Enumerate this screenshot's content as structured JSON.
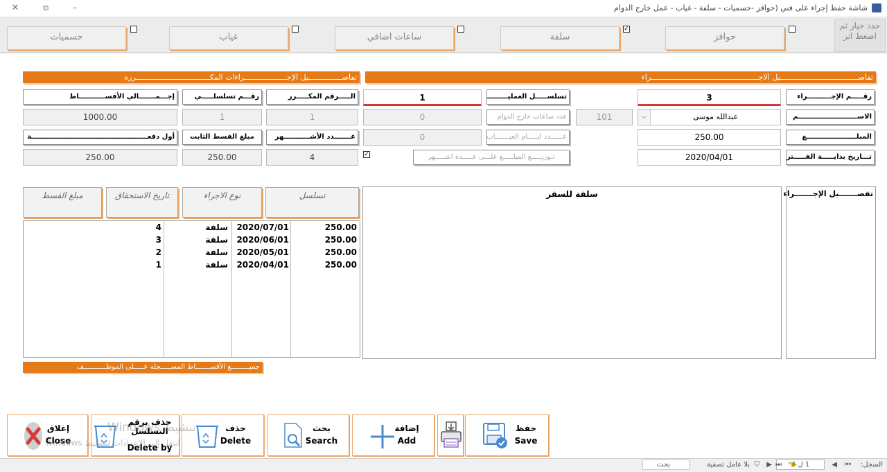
{
  "window": {
    "title": "شاشة حفظ إجراء على فني (حوافز -حسميات - سلفة - غياب - عمل خارج الدوام"
  },
  "categories": {
    "hint": "حدد خيار ثم اضغط اثر",
    "items": [
      {
        "label": "حوافز",
        "checked": false
      },
      {
        "label": "سلفة",
        "checked": true
      },
      {
        "label": "ساعات اضافي",
        "checked": false
      },
      {
        "label": "غياب",
        "checked": false
      },
      {
        "label": "حسميات",
        "checked": false
      }
    ]
  },
  "sections": {
    "right_title": "تفاصـــــــــــــــــــــــــــــــــــيل الاجــــــــــــــــــــــــــــــــــــــــــــــــراء",
    "left_title": "تفاصـــــــــــــــيل الإجـــــــــــــــــــراءات المكـــــــــــــــــــــــــــــــــرره"
  },
  "labels": {
    "proc_no": "رقـــــم الإجــــــــــراء",
    "op_seq": "تسلســـــل العمليـــــــــة",
    "name": "الاســـــــــــــــــــــــــم",
    "overtime_hours": "عدد ساعات خارج الدوام",
    "amount": "المبلـــــــــــــــــــــغ",
    "absence_days": "عــــــدد ايـــــام الغيـــــــاب",
    "period_start": "تـــاريخ بدايـــــة الفـــــترة",
    "distribute": "تـوزيـــــع المبلـــــغ علـــى عـــــدة اشـــــهر",
    "total_installments": "إجـــمـــــــالي الأقســـــــــــاط",
    "serial_no": "رقـــم تسلسلـــــي",
    "repeated_no": "الـــــرقم المكـــــرر",
    "months_count": "عـــــــدد الأشـــــــــــهر",
    "fixed_installment": "مبلغ القسط الثابت",
    "first_payment": "أول دفعـــــــــــــــــــــــــــــــــــــــــــــــــة",
    "proc_detail": "تفصـــــــيل الإجـــــــراء"
  },
  "values": {
    "proc_no": "3",
    "op_seq": "1",
    "name": "عبدالله موسى",
    "name_code": "101",
    "overtime_hours": "0",
    "amount": "250.00",
    "absence_days": "0",
    "period_start": "2020/04/01",
    "distribute_checked": true,
    "total_installments": "1000.00",
    "serial_no": "1",
    "repeated_no": "1",
    "months_count": "4",
    "fixed_installment": "250.00",
    "first_payment": "250.00",
    "memo": "سلفة للسفر"
  },
  "grid": {
    "columns": [
      "تسلسل",
      "نوع الاجراء",
      "تاريخ الاستحقاق",
      "مبلغ القسط"
    ],
    "rows": [
      {
        "amount": "250.00",
        "date": "2020/07/01",
        "type": "سلفة",
        "seq": "4"
      },
      {
        "amount": "250.00",
        "date": "2020/06/01",
        "type": "سلفة",
        "seq": "3"
      },
      {
        "amount": "250.00",
        "date": "2020/05/01",
        "type": "سلفة",
        "seq": "2"
      },
      {
        "amount": "250.00",
        "date": "2020/04/01",
        "type": "سلفة",
        "seq": "1"
      }
    ],
    "footer": "جميـــــــــع الأقســـــــاط المســـــجله عـــــلى الموظـــــــــــف"
  },
  "toolbar": {
    "save": {
      "ar": "حفظ",
      "en": "Save"
    },
    "add": {
      "ar": "إضافة",
      "en": "Add"
    },
    "search": {
      "ar": "بحث",
      "en": "Search"
    },
    "delete": {
      "ar": "حذف",
      "en": "Delete"
    },
    "delete_by": {
      "ar": "حذف برقم التسلسل",
      "en": "Delete by"
    },
    "close": {
      "ar": "إغلاق",
      "en": "Close"
    }
  },
  "watermark": {
    "line1": "تنشيط Windows",
    "line2": "انتقل إلى الإعدادات لتنشيط Windows"
  },
  "status": {
    "record_label": "السجل:",
    "record_value": "1 ل 4",
    "filter": "بلا عامل تصفية",
    "search": "بحث"
  },
  "colors": {
    "accent": "#e47b18",
    "accent_light": "#e8a76a",
    "field_red": "#dd3333"
  }
}
